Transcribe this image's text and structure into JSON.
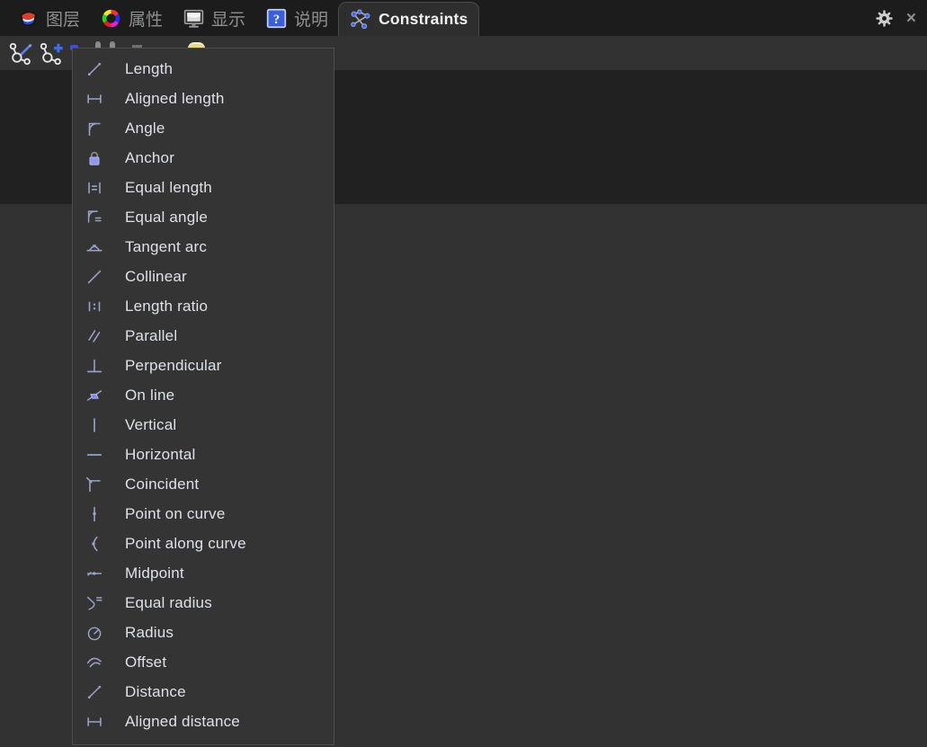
{
  "tabs": {
    "items": [
      {
        "name": "layers",
        "icon": "layers-icon",
        "label": "图层",
        "active": false
      },
      {
        "name": "properties",
        "icon": "color-wheel-icon",
        "label": "属性",
        "active": false
      },
      {
        "name": "display",
        "icon": "display-icon",
        "label": "显示",
        "active": false
      },
      {
        "name": "help",
        "icon": "help-icon",
        "label": "说明",
        "active": false
      },
      {
        "name": "constraints",
        "icon": "constraints-icon",
        "label": "Constraints",
        "active": true
      }
    ],
    "close_glyph": "×"
  },
  "toolbar": {
    "buttons": [
      {
        "name": "edit-constraints",
        "icon": "edit-constraints-icon"
      },
      {
        "name": "add-constraint",
        "icon": "add-constraint-icon"
      }
    ]
  },
  "menu": {
    "items": [
      {
        "name": "length",
        "icon": "length-icon",
        "label": "Length"
      },
      {
        "name": "aligned-length",
        "icon": "aligned-length-icon",
        "label": "Aligned length"
      },
      {
        "name": "angle",
        "icon": "angle-icon",
        "label": "Angle"
      },
      {
        "name": "anchor",
        "icon": "anchor-icon",
        "label": "Anchor"
      },
      {
        "name": "equal-length",
        "icon": "equal-length-icon",
        "label": "Equal length"
      },
      {
        "name": "equal-angle",
        "icon": "equal-angle-icon",
        "label": "Equal angle"
      },
      {
        "name": "tangent-arc",
        "icon": "tangent-arc-icon",
        "label": "Tangent arc"
      },
      {
        "name": "collinear",
        "icon": "collinear-icon",
        "label": "Collinear"
      },
      {
        "name": "length-ratio",
        "icon": "length-ratio-icon",
        "label": "Length ratio"
      },
      {
        "name": "parallel",
        "icon": "parallel-icon",
        "label": "Parallel"
      },
      {
        "name": "perpendicular",
        "icon": "perpendicular-icon",
        "label": "Perpendicular"
      },
      {
        "name": "on-line",
        "icon": "on-line-icon",
        "label": "On line"
      },
      {
        "name": "vertical",
        "icon": "vertical-icon",
        "label": "Vertical"
      },
      {
        "name": "horizontal",
        "icon": "horizontal-icon",
        "label": "Horizontal"
      },
      {
        "name": "coincident",
        "icon": "coincident-icon",
        "label": "Coincident"
      },
      {
        "name": "point-on-curve",
        "icon": "point-on-curve-icon",
        "label": "Point on curve"
      },
      {
        "name": "point-along-curve",
        "icon": "point-along-curve-icon",
        "label": "Point along curve"
      },
      {
        "name": "midpoint",
        "icon": "midpoint-icon",
        "label": "Midpoint"
      },
      {
        "name": "equal-radius",
        "icon": "equal-radius-icon",
        "label": "Equal radius"
      },
      {
        "name": "radius",
        "icon": "radius-icon",
        "label": "Radius"
      },
      {
        "name": "offset",
        "icon": "offset-icon",
        "label": "Offset"
      },
      {
        "name": "distance",
        "icon": "distance-icon",
        "label": "Distance"
      },
      {
        "name": "aligned-distance",
        "icon": "aligned-distance-icon",
        "label": "Aligned distance"
      }
    ]
  },
  "colors": {
    "tabbar_bg": "#1c1c1c",
    "active_tab_bg": "#2e2e2e",
    "active_tab_text": "#f2f2f2",
    "inactive_tab_text": "#8f8f8f",
    "panel_bg": "#323232",
    "dark_band": "#212121",
    "menu_bg": "#343434",
    "menu_text": "#dde1ea",
    "menu_icon": "#9ba2c8",
    "accent_blue": "#3f66dd",
    "lock_blue": "#8f9aec"
  }
}
